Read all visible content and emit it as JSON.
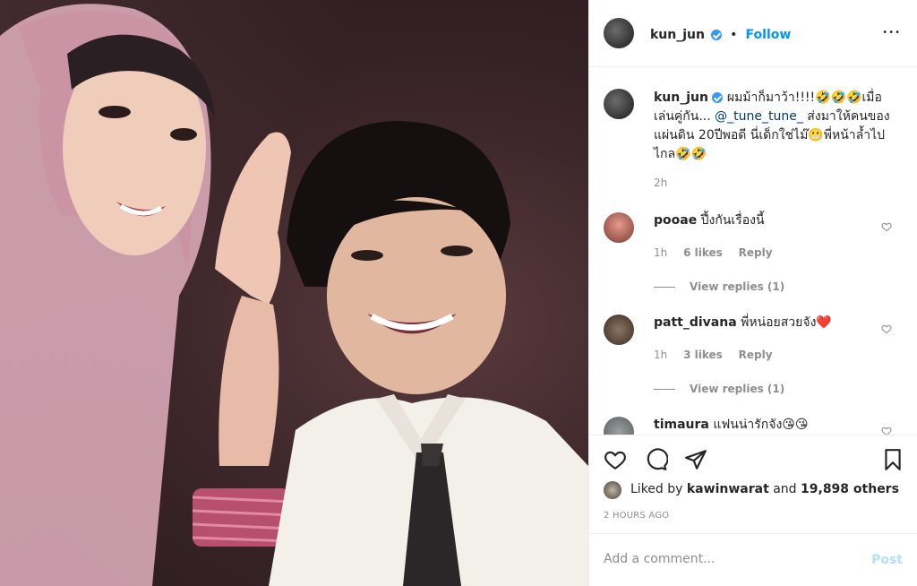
{
  "post": {
    "author": "kun_jun",
    "follow_label": "Follow",
    "dot_sep": "•",
    "more_label": "•••"
  },
  "caption": {
    "author": "kun_jun",
    "text_before": "ผมม้าก็มาว้า!!!!🤣🤣🤣เมื่อเล่นคู่กัน... ",
    "mention": "@_tune_tune_",
    "text_after": " ส่งมาให้คนของแผ่นดิน 20ปีพอดี นี่เด็กใช่ไม๊😬พี่หน้าล้ำไปไกล🤣🤣",
    "time": "2h"
  },
  "comments": [
    {
      "user": "pooae",
      "text": "ปึ้งกันเรื่องนี้",
      "time": "1h",
      "likes": "6 likes",
      "reply": "Reply",
      "view_replies": "View replies (1)"
    },
    {
      "user": "patt_divana",
      "text": "พี่หน่อยสวยจัง❤️",
      "time": "1h",
      "likes": "3 likes",
      "reply": "Reply",
      "view_replies": "View replies (1)"
    },
    {
      "user": "timaura",
      "text": "แฟนน่ารักจัง😘😘"
    }
  ],
  "liked_by": {
    "prefix": "Liked by ",
    "user": "kawinwarat",
    "middle": " and ",
    "count": "19,898 others"
  },
  "timestamp": "2 HOURS AGO",
  "add_comment": {
    "placeholder": "Add a comment...",
    "post_label": "Post"
  },
  "colors": {
    "accent": "#0095f6",
    "post_disabled": "#b2dffc",
    "muted": "#8e8e8e",
    "verified": "#3897f0"
  },
  "icons": [
    "heart-icon",
    "comment-icon",
    "share-icon",
    "bookmark-icon",
    "verified-icon",
    "more-options-icon"
  ]
}
